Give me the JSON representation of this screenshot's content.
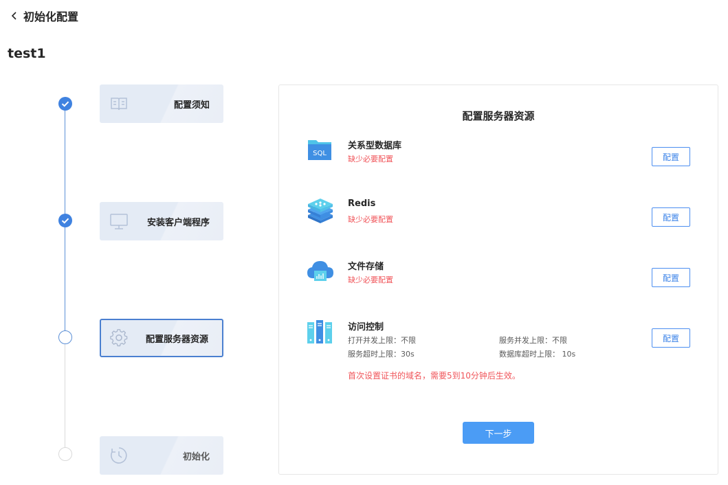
{
  "header": {
    "back_title": "初始化配置"
  },
  "app": {
    "name": "test1"
  },
  "steps": [
    {
      "label": "配置须知",
      "state": "done",
      "icon": "book-icon"
    },
    {
      "label": "安装客户端程序",
      "state": "done",
      "icon": "monitor-icon"
    },
    {
      "label": "配置服务器资源",
      "state": "current",
      "icon": "gear-icon"
    },
    {
      "label": "初始化",
      "state": "pending",
      "icon": "clock-icon"
    }
  ],
  "panel": {
    "title": "配置服务器资源",
    "resources": [
      {
        "name": "关系型数据库",
        "status": "缺少必要配置",
        "icon": "sql-folder-icon",
        "button": "配置"
      },
      {
        "name": "Redis",
        "status": "缺少必要配置",
        "icon": "redis-stack-icon",
        "button": "配置"
      },
      {
        "name": "文件存储",
        "status": "缺少必要配置",
        "icon": "cloud-storage-icon",
        "button": "配置"
      },
      {
        "name": "访问控制",
        "icon": "server-rack-icon",
        "button": "配置",
        "rows": {
          "open_concurrency": "打开并发上限：不限",
          "service_concurrency": "服务并发上限：不限",
          "service_timeout": "服务超时上限：30s",
          "db_timeout": "数据库超时上限： 10s"
        }
      }
    ],
    "warning": "首次设置证书的域名，需要5到10分钟后生效。",
    "next_button": "下一步"
  },
  "colors": {
    "accent": "#3f82e0",
    "danger": "#f0555a",
    "primary_button": "#4b9cf5"
  }
}
